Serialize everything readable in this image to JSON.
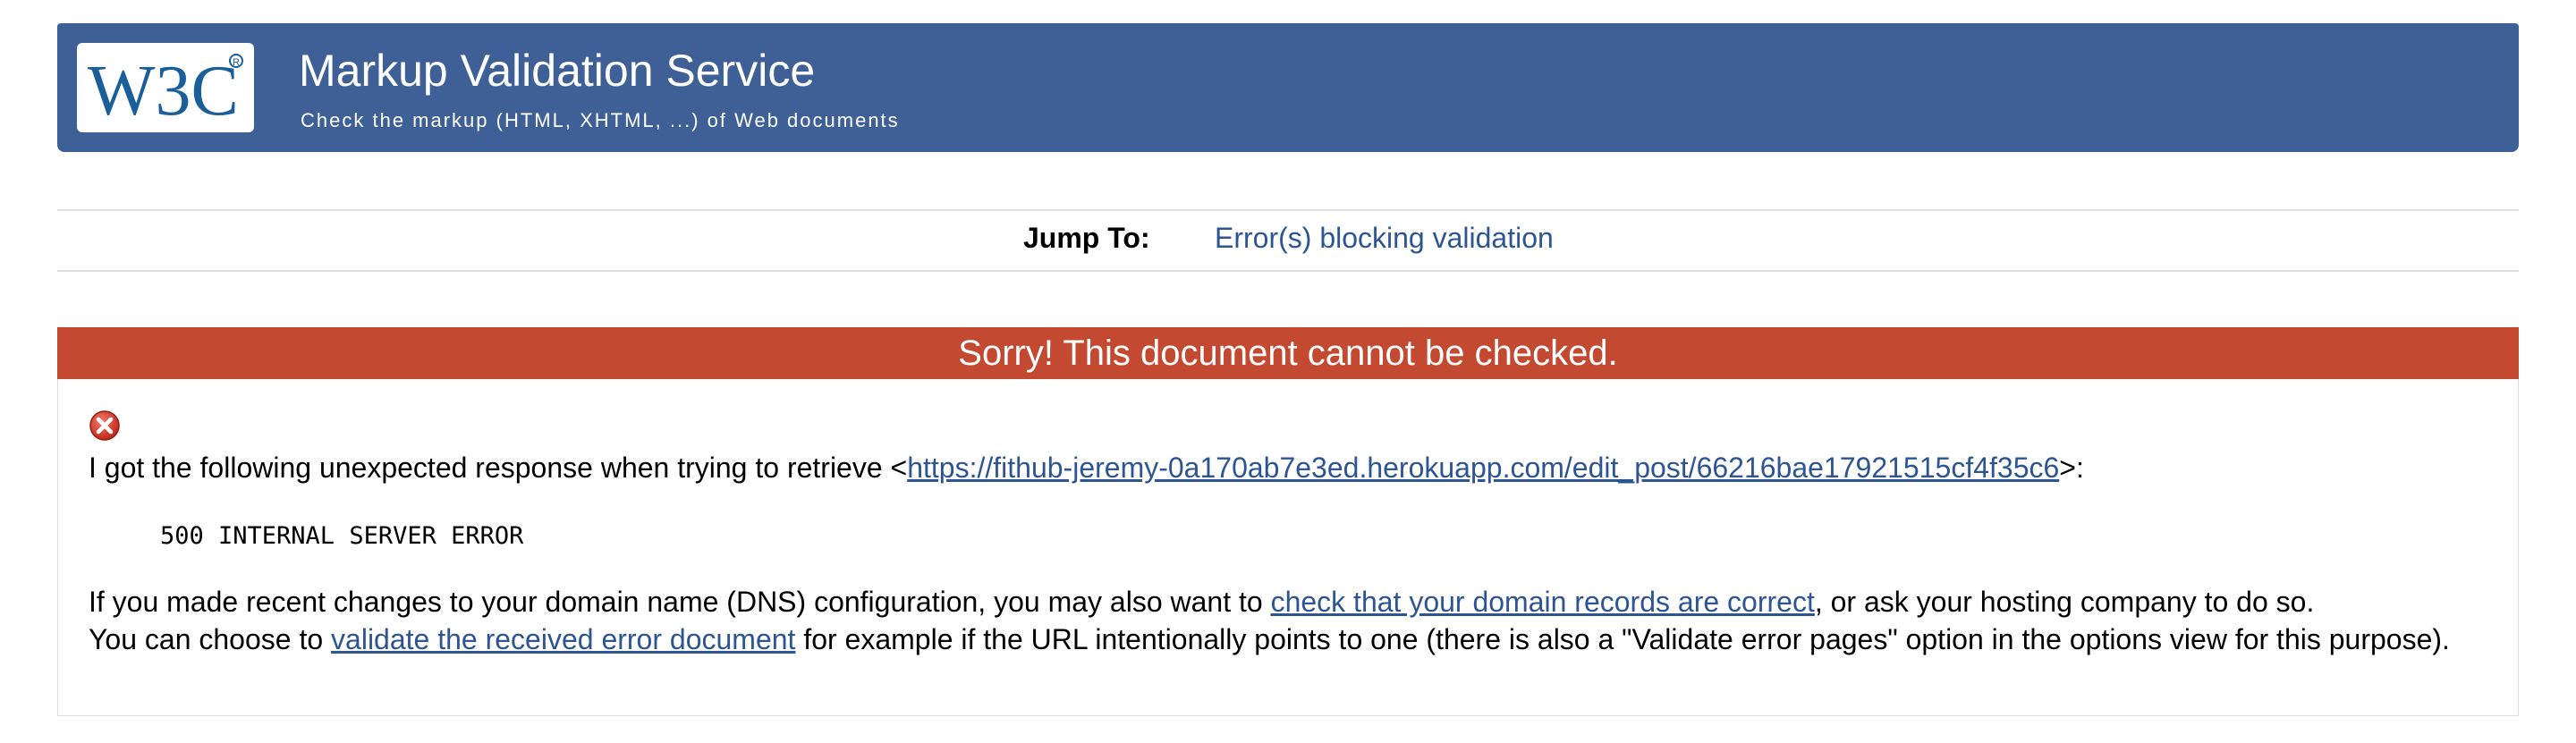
{
  "header": {
    "logo_text": "W3C",
    "title": "Markup Validation Service",
    "subtitle": "Check the markup (HTML, XHTML, ...) of Web documents"
  },
  "jump": {
    "label": "Jump To:",
    "link": "Error(s) blocking validation"
  },
  "error": {
    "heading": "Sorry! This document cannot be checked.",
    "icon": "error-x-icon",
    "line1_prefix": "I got the following unexpected response when trying to retrieve <",
    "line1_url": "https://fithub-jeremy-0a170ab7e3ed.herokuapp.com/edit_post/66216bae17921515cf4f35c6",
    "line1_suffix": ">:",
    "response_code": "500 INTERNAL SERVER ERROR",
    "line2_prefix": "If you made recent changes to your domain name (DNS) configuration, you may also want to ",
    "line2_link": "check that your domain records are correct",
    "line2_suffix": ", or ask your hosting company to do so.",
    "line3_prefix": "You can choose to ",
    "line3_link": "validate the received error document",
    "line3_suffix": " for example if the URL intentionally points to one (there is also a \"Validate error pages\" option in the options view for this purpose)."
  },
  "colors": {
    "banner_bg": "#3e6096",
    "error_header_bg": "#c34931",
    "link": "#2d5493",
    "logo_blue": "#1a5e9a"
  }
}
